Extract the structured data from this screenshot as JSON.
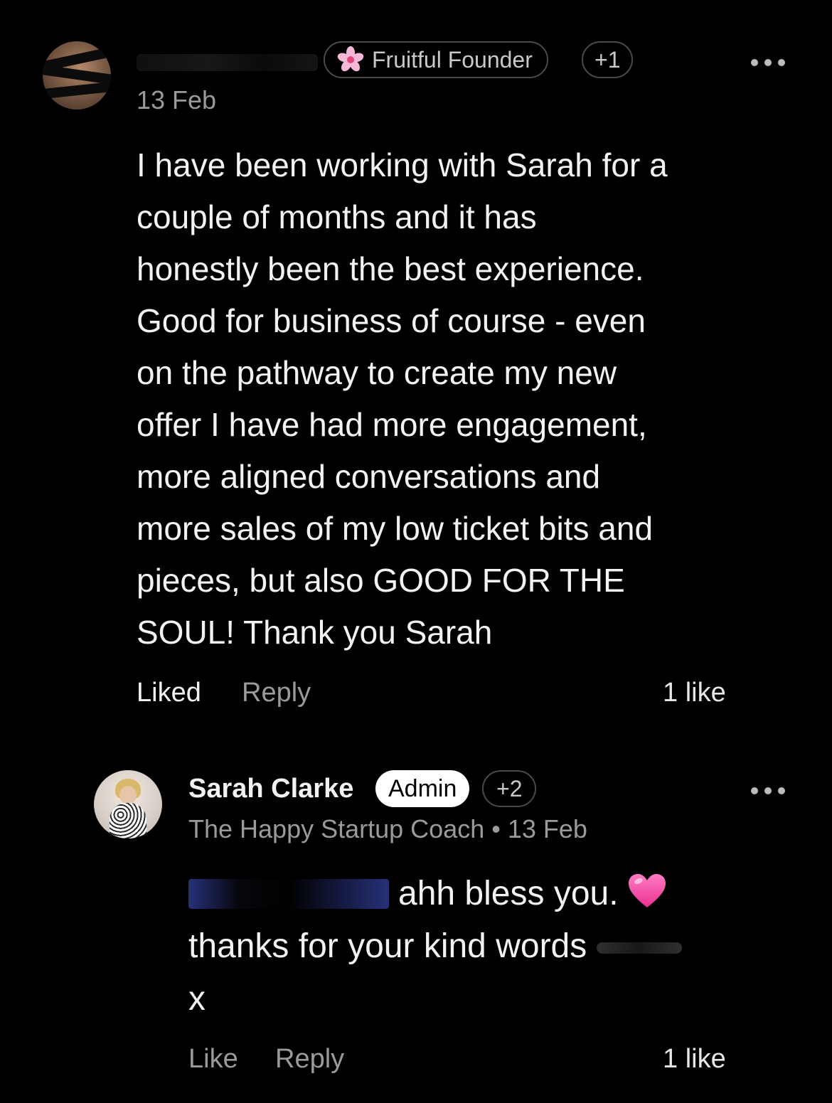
{
  "comments": [
    {
      "date": "13 Feb",
      "badges": {
        "title_badge": "Fruitful Founder",
        "extra_badges": "+1",
        "title_badge_icon": "flower-icon"
      },
      "body_lines": [
        "I have been working with Sarah for a",
        "couple of months and it has",
        "honestly been the best experience.",
        "Good for business of course - even",
        "on the pathway to create my new",
        "offer I have had more engagement,",
        "more aligned conversations and",
        "more sales of my low ticket bits and",
        "pieces, but also GOOD FOR THE",
        "SOUL! Thank you Sarah"
      ],
      "actions": {
        "like_label": "Liked",
        "reply_label": "Reply",
        "like_count": "1 like"
      }
    },
    {
      "author": "Sarah Clarke",
      "role_badge": "Admin",
      "extra_badges": "+2",
      "subtitle": "The Happy Startup Coach",
      "separator": "•",
      "date": "13 Feb",
      "body_line1": "ahh bless you.",
      "body_line2": "thanks for your kind words",
      "body_line3": "x",
      "emoji": "pink-heart-icon",
      "actions": {
        "like_label": "Like",
        "reply_label": "Reply",
        "like_count": "1 like"
      }
    }
  ],
  "colors": {
    "background": "#000000",
    "text_primary": "#f2f2f2",
    "text_secondary": "#9a9a9a",
    "pill_border": "#4a4a4a",
    "admin_badge_bg": "#ffffff",
    "heart": "#ff4fa8"
  }
}
